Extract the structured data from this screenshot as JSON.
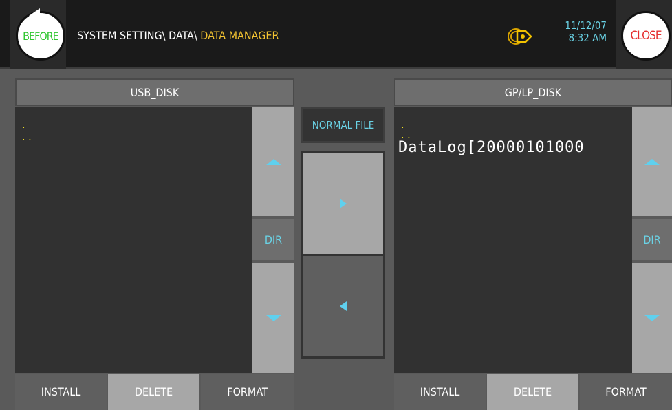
{
  "header": {
    "before_label": "BEFORE",
    "close_label": "CLOSE",
    "breadcrumb_path": "SYSTEM SETTING\\ DATA\\ ",
    "breadcrumb_current": "DATA MANAGER",
    "date": "11/12/07",
    "time": "8:32 AM"
  },
  "left_panel": {
    "title": "USB_DISK",
    "items": [
      ".",
      ". ."
    ],
    "dir_label": "DIR",
    "buttons": {
      "install": "INSTALL",
      "delete": "DELETE",
      "format": "FORMAT"
    }
  },
  "center": {
    "file_type": "NORMAL FILE"
  },
  "right_panel": {
    "title": "GP/LP_DISK",
    "items": [
      ".",
      ". ."
    ],
    "file": "DataLog[20000101000",
    "dir_label": "DIR",
    "buttons": {
      "install": "INSTALL",
      "delete": "DELETE",
      "format": "FORMAT"
    }
  },
  "colors": {
    "accent_cyan": "#6ad3e6",
    "path_highlight": "#f4c431",
    "close_red": "#e53030",
    "before_green": "#2ec52e"
  }
}
